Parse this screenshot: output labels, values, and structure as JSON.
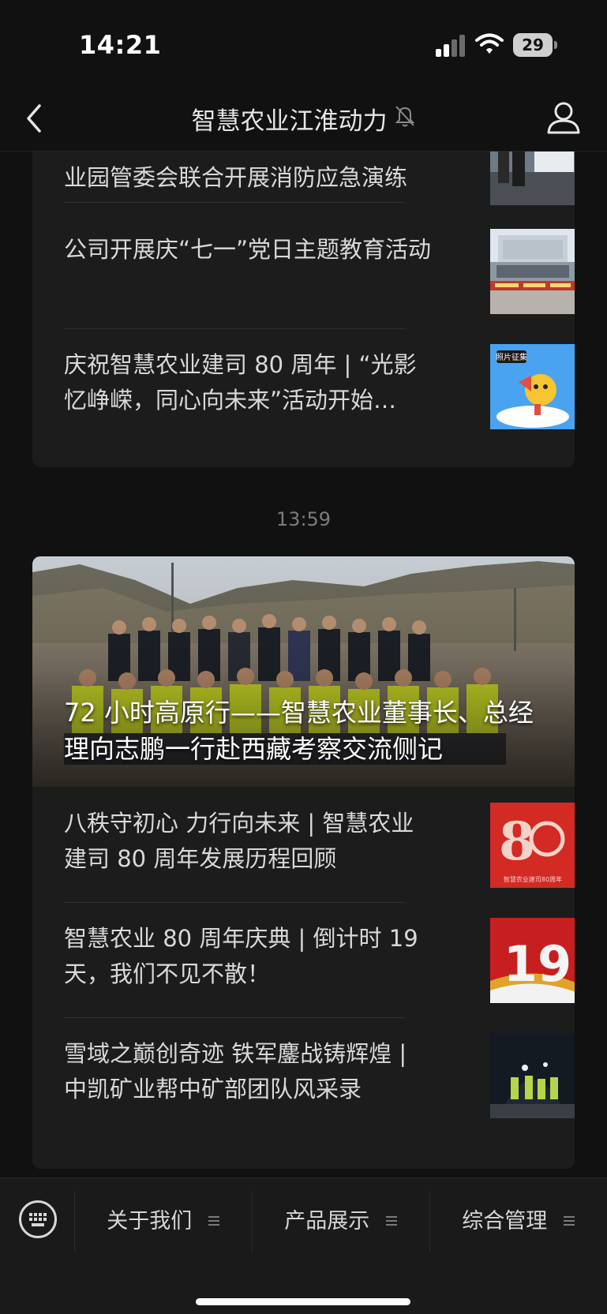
{
  "status_bar": {
    "time": "14:21",
    "battery": "29"
  },
  "nav": {
    "title": "智慧农业江淮动力"
  },
  "top_card": {
    "items": [
      {
        "title": "…联合开展…（顶部已截断）业园管委会联合开展消防应急演练",
        "visible_title": "业园管委会联合开展消防应急演练"
      },
      {
        "title": "公司开展庆“七一”党日主题教育活动"
      },
      {
        "title": "庆祝智慧农业建司 80 周年 | “光影忆峥嵘，同心向未来”活动开始…"
      }
    ]
  },
  "timestamp": "13:59",
  "bottom_card": {
    "hero_title": "72 小时高原行——智慧农业董事长、总经理向志鹏一行赴西藏考察交流侧记",
    "items": [
      {
        "title": "八秩守初心  力行向未来 | 智慧农业建司 80 周年发展历程回顾",
        "thumb_text": "智慧农业建司80周年"
      },
      {
        "title": "智慧农业 80 周年庆典 | 倒计时 19 天，我们不见不散！",
        "thumb_text": "19"
      },
      {
        "title": "雪域之巅创奇迹  铁军鏖战铸辉煌 | 中凯矿业帮中矿部团队风采录"
      }
    ]
  },
  "menu": {
    "items": [
      {
        "label": "关于我们"
      },
      {
        "label": "产品展示"
      },
      {
        "label": "综合管理"
      }
    ]
  },
  "thumb_labels": {
    "photo_collect": "照片征集"
  }
}
